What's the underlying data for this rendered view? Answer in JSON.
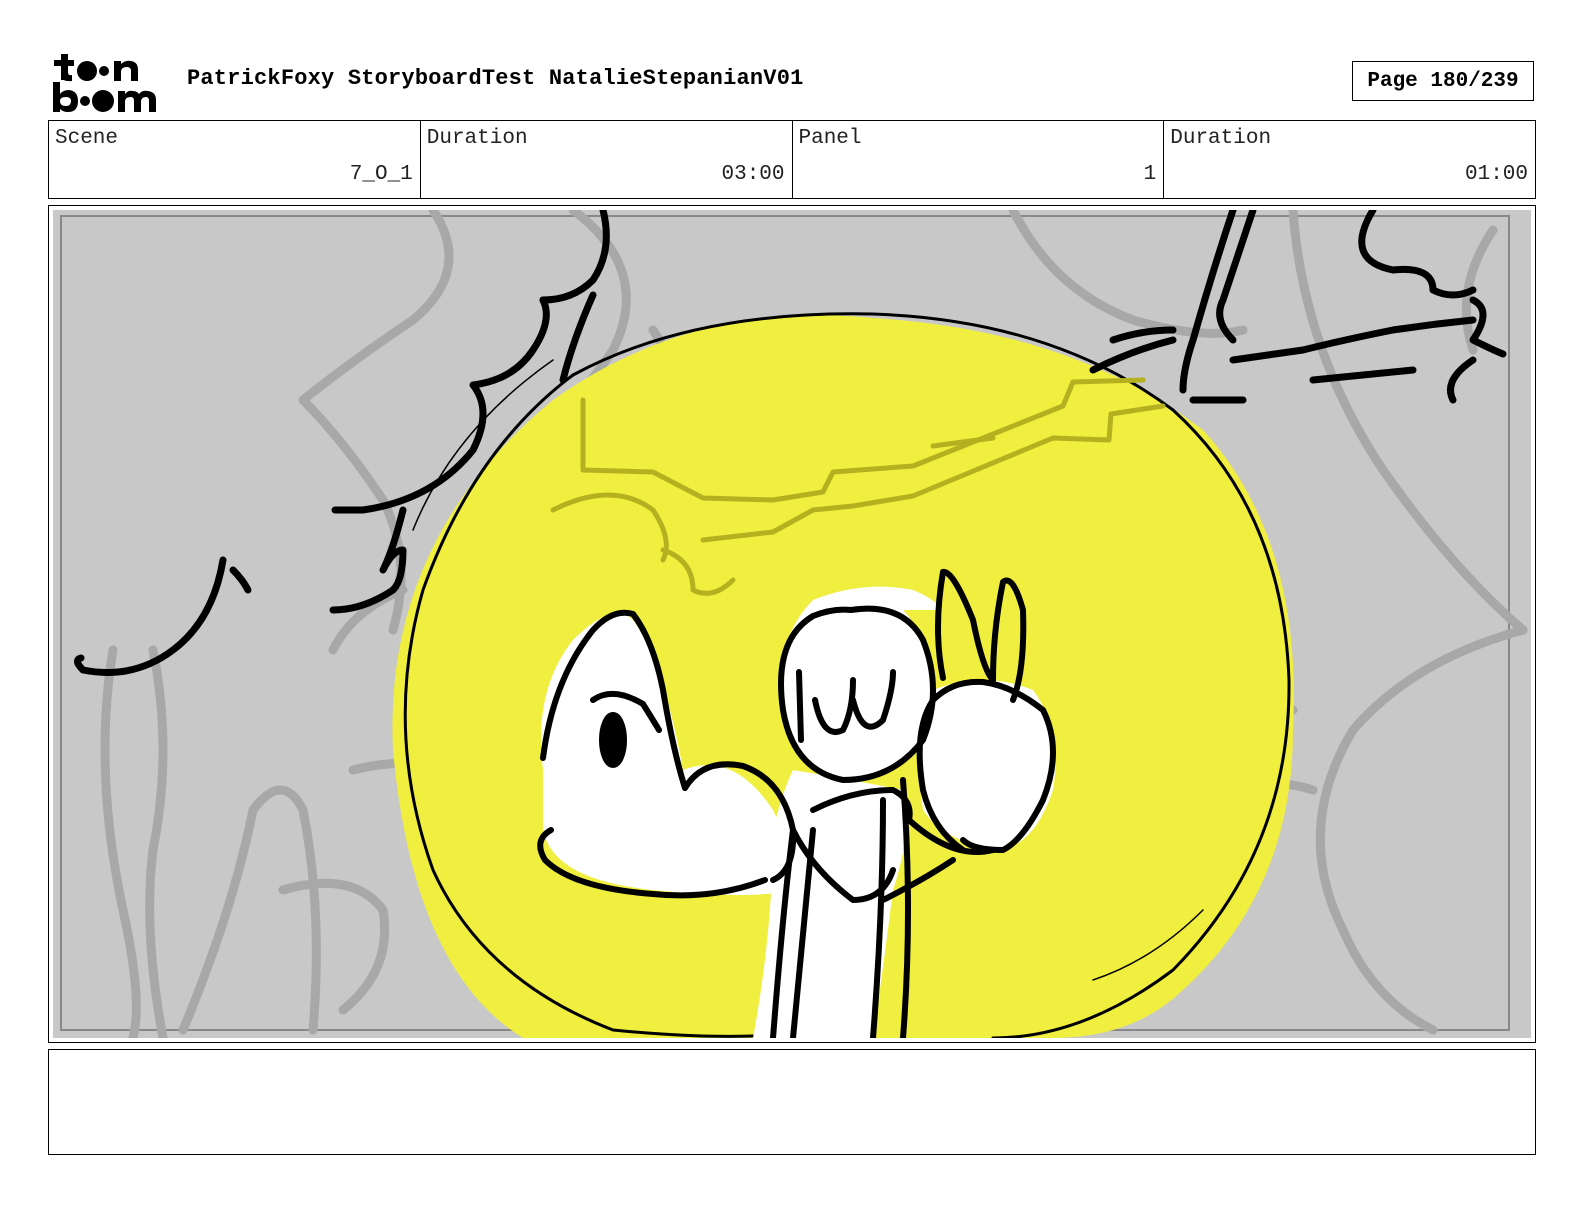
{
  "header": {
    "logo_text": "toon boom",
    "title": "PatrickFoxy StoryboardTest NatalieStepanianV01",
    "page_label": "Page 180/239"
  },
  "info": {
    "scene_label": "Scene",
    "scene_value": "7_O_1",
    "scene_duration_label": "Duration",
    "scene_duration_value": "03:00",
    "panel_label": "Panel",
    "panel_value": "1",
    "panel_duration_label": "Duration",
    "panel_duration_value": "01:00"
  },
  "panel": {
    "background_color": "#c8c8c8",
    "spotlight_color": "#f0ee3e",
    "sketch_color": "#000000",
    "underlay_color": "#a8a8a8"
  },
  "notes": {
    "text": ""
  }
}
